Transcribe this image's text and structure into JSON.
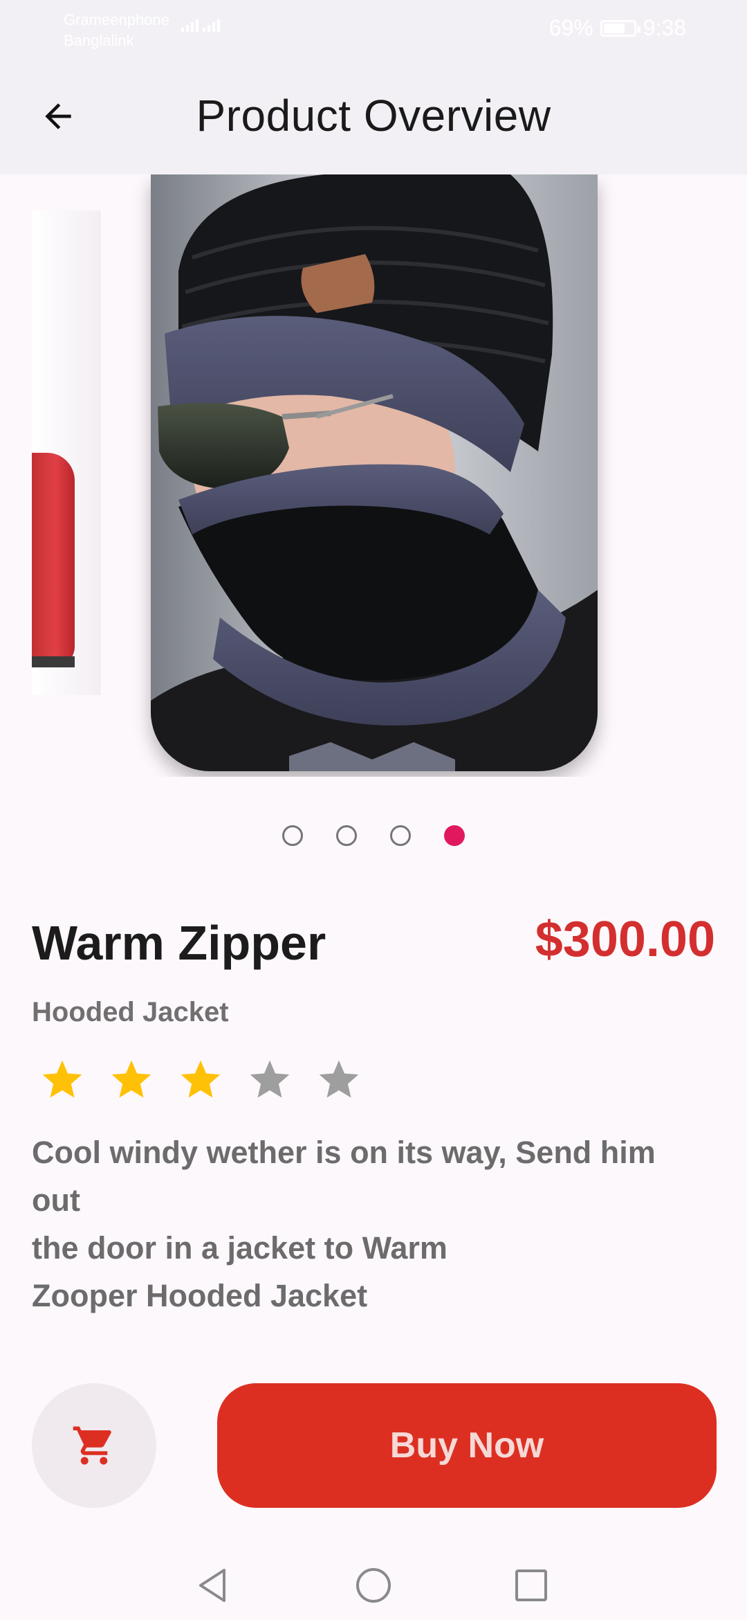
{
  "status_bar": {
    "carrier_1": "Grameenphone",
    "carrier_2": "Banglalink",
    "battery": "69%",
    "battery_level": 0.69,
    "time": "9:38"
  },
  "app_bar": {
    "title": "Product Overview",
    "back_icon": "arrow-left-icon"
  },
  "carousel": {
    "page_count": 4,
    "active_index": 3,
    "active_color": "#e0195f"
  },
  "product": {
    "name": "Warm Zipper",
    "price": "$300.00",
    "subtitle": "Hooded Jacket",
    "rating": 3,
    "rating_max": 5,
    "description_lines": [
      "Cool windy wether is on its way, Send him",
      "out",
      "the door in a jacket to Warm",
      "Zooper Hooded Jacket"
    ]
  },
  "actions": {
    "cart_icon": "shopping-cart-icon",
    "buy_label": "Buy Now"
  },
  "colors": {
    "accent_red": "#dc2f22",
    "price_red": "#d32f2f",
    "star_filled": "#ffc107",
    "star_empty": "#9e9e9e"
  },
  "nav_bar": {
    "icons": [
      "back-triangle-icon",
      "home-circle-icon",
      "recents-square-icon"
    ]
  }
}
